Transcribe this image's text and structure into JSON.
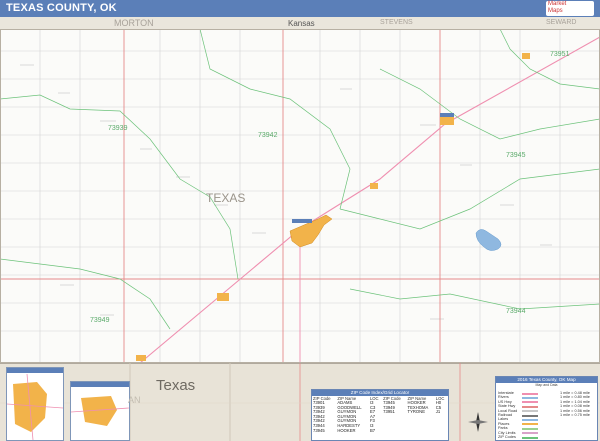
{
  "header": {
    "title": "TEXAS COUNTY, OK",
    "logo_text_1": "Market",
    "logo_text_2": "Maps"
  },
  "neighbors": {
    "north_west": "MORTON",
    "north_center": "Kansas",
    "north_east_1": "STEVENS",
    "north_east_2": "SEWARD"
  },
  "map": {
    "county_label": "TEXAS",
    "zip_labels": [
      "73939",
      "73942",
      "73945",
      "73951",
      "73949",
      "73944"
    ]
  },
  "bottom": {
    "state_label": "Texas",
    "county_fragment": "AN"
  },
  "zip_table": {
    "title": "ZIP Code Index/Grid Locator",
    "headers": [
      "ZIP Code",
      "ZIP Name",
      "LOC",
      "ZIP Code",
      "ZIP Name",
      "LOC"
    ],
    "rows": [
      [
        "73901",
        "ADAMS",
        "I3",
        "73945",
        "HOOKER",
        "H0"
      ],
      [
        "73939",
        "GOODWELL",
        "C3",
        "73949",
        "TEXHOMA",
        "C5"
      ],
      [
        "73942",
        "GUYMON",
        "E7",
        "73951",
        "TYRONE",
        "J1"
      ],
      [
        "73942",
        "GUYMON",
        "A7",
        "",
        "",
        ""
      ],
      [
        "73942",
        "GUYMON",
        "F3",
        "",
        "",
        ""
      ],
      [
        "73944",
        "HARDESTY",
        "I3",
        "",
        "",
        ""
      ],
      [
        "73945",
        "HOOKER",
        "B7",
        "",
        "",
        ""
      ]
    ]
  },
  "legend": {
    "title": "2016 Texas County, OK Map",
    "subtitle": "Map and Data",
    "rows_left": [
      "Interstate",
      "Rivers",
      "US Hwy",
      "State Hwy",
      "Local Road",
      "Railroad",
      "Lakes",
      "Places",
      "Parks",
      "City Limits",
      "ZIP Codes"
    ],
    "rows_right": [
      "1 mile = 0.48 mile",
      "1 mile = 0.80 mile",
      "1 mile = 1.04 mile",
      "1 mile = 0.08 mile",
      "1 mile = 0.56 mile",
      "1 mile = 0.75 mile"
    ]
  },
  "colors": {
    "header": "#5b7fb8",
    "city": "#f2b34a",
    "zip_boundary": "#6cc27a",
    "county_line": "#e58a8a",
    "highway": "#ee9c9c",
    "road": "#c8c8c8",
    "lake": "#8fb8e0"
  }
}
